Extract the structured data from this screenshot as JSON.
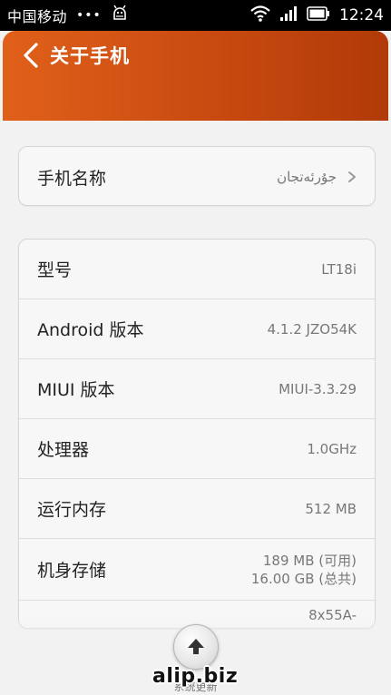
{
  "status_bar": {
    "carrier": "中国移动",
    "dots": "•••",
    "time": "12:24"
  },
  "header": {
    "title": "关于手机",
    "back_icon": "chevron-left-icon",
    "gradient": [
      "#e0601a",
      "#b13a08"
    ]
  },
  "device_name_row": {
    "label": "手机名称",
    "value": "جۇرئەتجان"
  },
  "info_rows": [
    {
      "label": "型号",
      "value": "LT18i"
    },
    {
      "label": "Android 版本",
      "value": "4.1.2 JZO54K"
    },
    {
      "label": "MIUI 版本",
      "value": "MIUI-3.3.29"
    },
    {
      "label": "处理器",
      "value": "1.0GHz"
    },
    {
      "label": "运行内存",
      "value": "512 MB"
    },
    {
      "label": "机身存储",
      "value": "189 MB (可用)",
      "value2": "16.00 GB (总共)"
    },
    {
      "label": "",
      "value": "8x55A-"
    }
  ],
  "bottom": {
    "update_button_icon": "upload-arrow-icon",
    "update_label": "系统更新",
    "watermark": "alip.biz"
  }
}
